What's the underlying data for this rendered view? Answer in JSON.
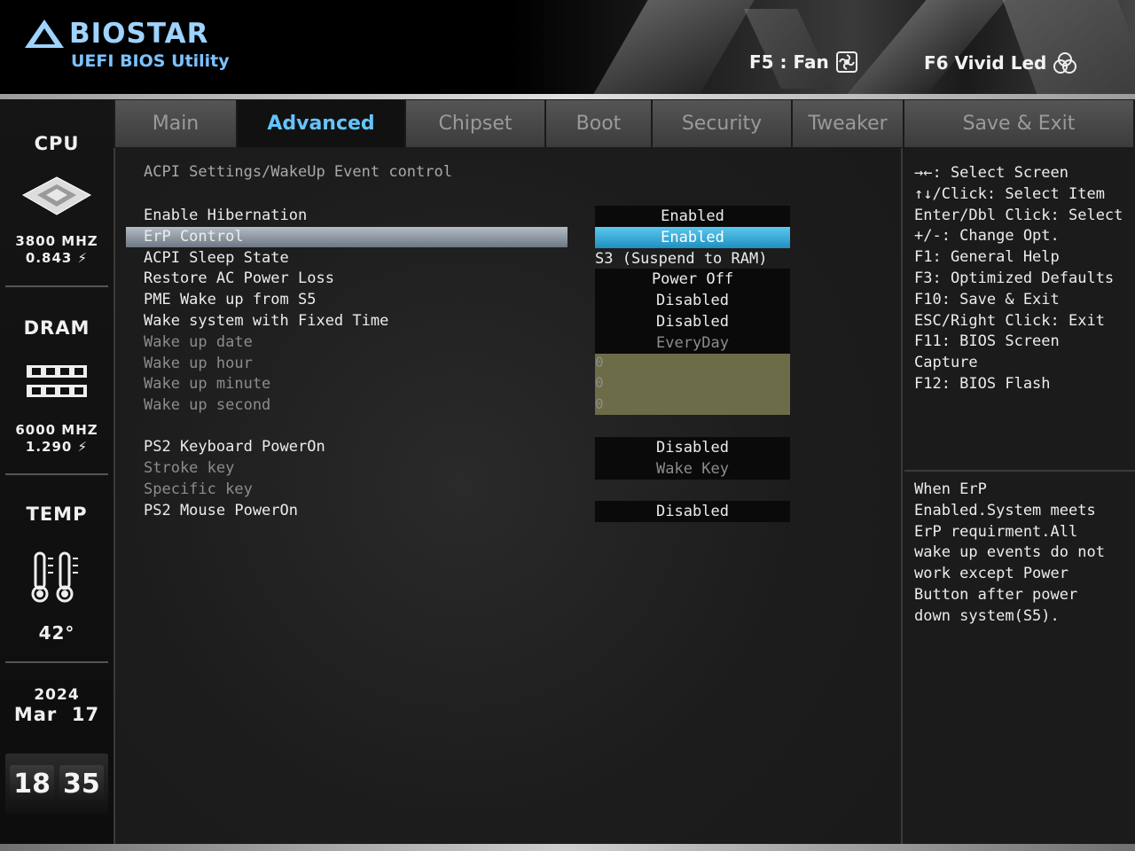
{
  "brand": {
    "name": "BIOSTAR",
    "subtitle": "UEFI BIOS Utility"
  },
  "hotkeys": [
    {
      "label": "F5 : Fan",
      "icon": "fan-icon"
    },
    {
      "label": "F6 Vivid Led",
      "icon": "led-icon"
    }
  ],
  "sidebar": {
    "cpu": {
      "title": "CPU",
      "speed": "3800 MHZ",
      "voltage": "0.843 ⚡"
    },
    "dram": {
      "title": "DRAM",
      "speed": "6000 MHZ",
      "voltage": "1.290 ⚡"
    },
    "temp": {
      "title": "TEMP",
      "value": "42°"
    },
    "date": {
      "year": "2024",
      "month_day": "Mar  17"
    },
    "clock": {
      "hour": "18",
      "minute": "35"
    }
  },
  "tabs": [
    "Main",
    "Advanced",
    "Chipset",
    "Boot",
    "Security",
    "Tweaker",
    "Save & Exit"
  ],
  "active_tab": "Advanced",
  "breadcrumb": "ACPI Settings/WakeUp Event control",
  "settings": [
    {
      "label": "Enable Hibernation",
      "value": "Enabled"
    },
    {
      "label": "ErP Control",
      "value": "Enabled"
    },
    {
      "label": "ACPI Sleep State",
      "value": "S3 (Suspend to RAM)"
    },
    {
      "label": "Restore AC Power Loss",
      "value": "Power Off"
    },
    {
      "label": "PME Wake up from S5",
      "value": "Disabled"
    },
    {
      "label": "Wake system with Fixed Time",
      "value": "Disabled"
    },
    {
      "label": "Wake up date",
      "value": "EveryDay"
    },
    {
      "label": "Wake up hour",
      "value": "0"
    },
    {
      "label": "Wake up minute",
      "value": "0"
    },
    {
      "label": "Wake up second",
      "value": "0"
    },
    {
      "label": "PS2 Keyboard PowerOn",
      "value": "Disabled"
    },
    {
      "label": "Stroke key",
      "value": "Wake Key"
    },
    {
      "label": "Specific key",
      "value": ""
    },
    {
      "label": "PS2 Mouse PowerOn",
      "value": "Disabled"
    }
  ],
  "selected_setting": "ErP Control",
  "help_keys": [
    "→←: Select Screen",
    "↑↓/Click: Select Item",
    "Enter/Dbl Click: Select",
    "+/-: Change Opt.",
    "F1: General Help",
    "F3: Optimized Defaults",
    "F10: Save & Exit",
    "ESC/Right Click: Exit",
    "F11: BIOS Screen",
    "Capture",
    "F12: BIOS Flash"
  ],
  "help_description": [
    "When ErP",
    "Enabled.System meets",
    "ErP requirment.All",
    "wake up events do not",
    "work except Power",
    "Button after power",
    "down system(S5)."
  ],
  "colors": {
    "accent": "#64c4ff",
    "selected_value": "#2fa6d6",
    "olive_field": "#6d6c48"
  }
}
